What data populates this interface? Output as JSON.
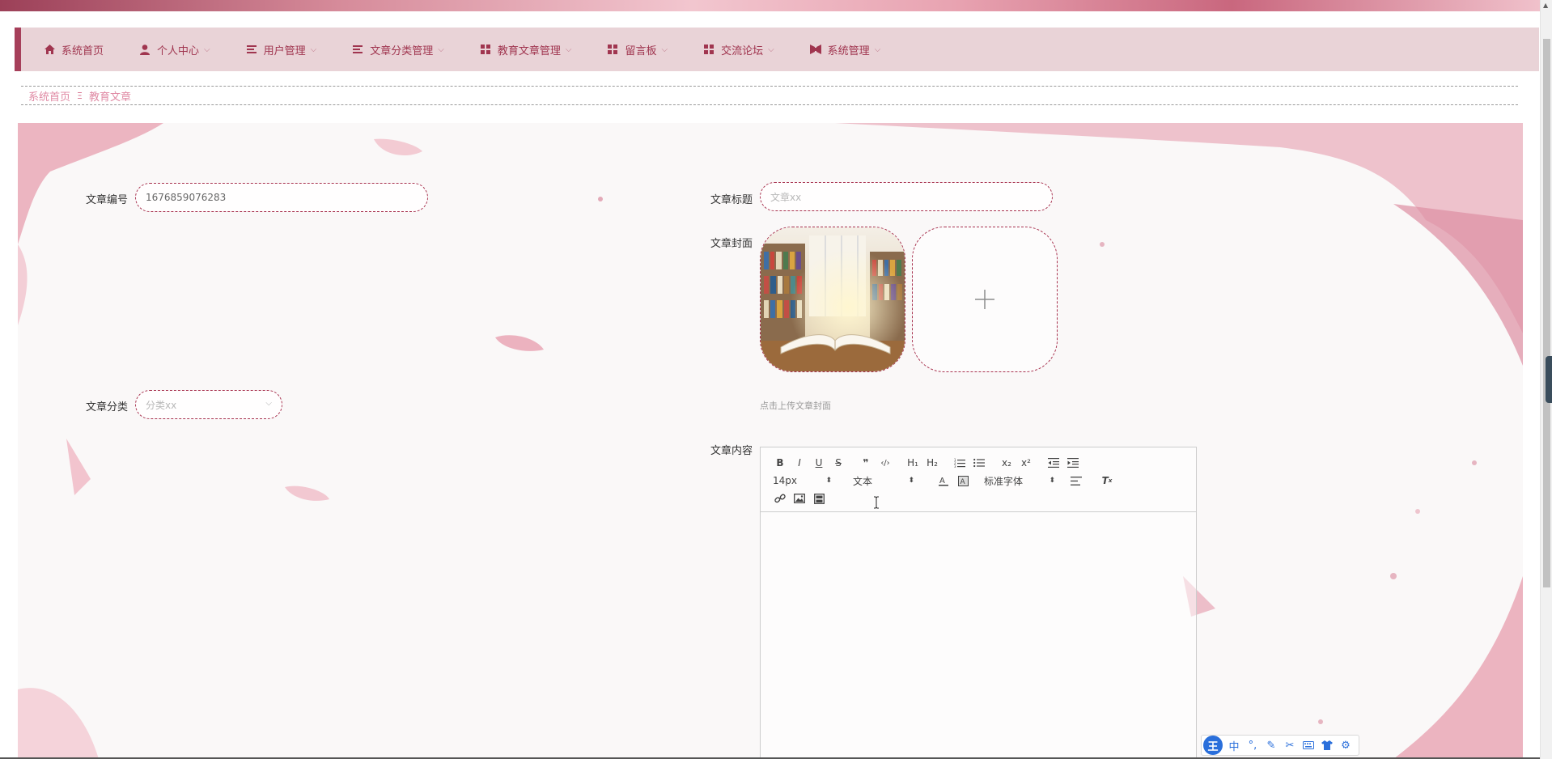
{
  "nav": {
    "items": [
      {
        "label": "系统首页",
        "icon": "home-icon",
        "has_dropdown": false
      },
      {
        "label": "个人中心",
        "icon": "user-icon",
        "has_dropdown": true
      },
      {
        "label": "用户管理",
        "icon": "list-icon",
        "has_dropdown": true
      },
      {
        "label": "文章分类管理",
        "icon": "list-icon",
        "has_dropdown": true
      },
      {
        "label": "教育文章管理",
        "icon": "grid-icon",
        "has_dropdown": true
      },
      {
        "label": "留言板",
        "icon": "grid-icon",
        "has_dropdown": true
      },
      {
        "label": "交流论坛",
        "icon": "grid-icon",
        "has_dropdown": true
      },
      {
        "label": "系统管理",
        "icon": "ribbon-icon",
        "has_dropdown": true
      }
    ]
  },
  "breadcrumb": {
    "home": "系统首页",
    "separator": "Ξ",
    "current": "教育文章"
  },
  "form": {
    "article_no": {
      "label": "文章编号",
      "value": "1676859076283"
    },
    "article_title": {
      "label": "文章标题",
      "placeholder": "文章xx"
    },
    "article_cover": {
      "label": "文章封面",
      "hint": "点击上传文章封面"
    },
    "article_category": {
      "label": "文章分类",
      "placeholder": "分类xx"
    },
    "article_content": {
      "label": "文章内容"
    }
  },
  "editor": {
    "font_size": "14px",
    "header": "文本",
    "font_family": "标准字体",
    "buttons_row1": [
      "bold-icon",
      "italic-icon",
      "underline-icon",
      "strike-icon",
      "blockquote-icon",
      "code-block-icon",
      "h1-icon",
      "h2-icon",
      "ordered-list-icon",
      "bullet-list-icon",
      "subscript-icon",
      "superscript-icon",
      "outdent-icon",
      "indent-icon"
    ],
    "glyphs": {
      "bold": "B",
      "italic": "I",
      "underline": "U",
      "strike": "S",
      "quote": "❞",
      "code": "‹/›",
      "h1": "H₁",
      "h2": "H₂",
      "sub": "x₂",
      "sup": "x²"
    }
  },
  "ime": {
    "logo": "王",
    "mode": "中"
  },
  "colors": {
    "accent": "#a63f5a",
    "nav_bg": "#e9d3d7",
    "breadcrumb": "#e08aa4"
  }
}
